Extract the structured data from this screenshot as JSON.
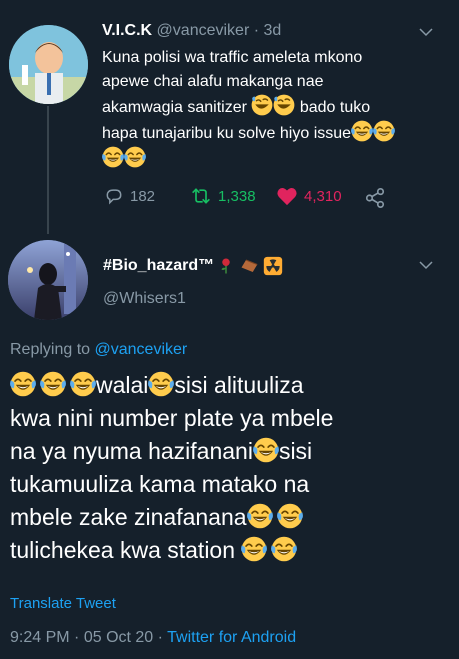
{
  "parent_tweet": {
    "display_name": "V.I.C.K",
    "handle": "@vanceviker",
    "time": "3d",
    "text_lines": [
      "Kuna polisi wa traffic ameleta mkono",
      "apewe chai alafu makanga nae",
      "akamwagia sanitizer",
      " bado tuko",
      "hapa tunajaribu ku solve hiyo issue"
    ],
    "replies": "182",
    "retweets": "1,338",
    "likes": "4,310",
    "icons": [
      "reply-icon",
      "retweet-icon",
      "heart-icon",
      "share-icon",
      "chevron-down-icon"
    ],
    "colors": {
      "retweet": "#17bf63",
      "like": "#e0245e"
    }
  },
  "main_tweet": {
    "display_name": "#Bio_hazard™",
    "handle": "@Whisers1",
    "replying_to_prefix": "Replying to",
    "replying_to_handle": "@vanceviker",
    "text_lines": [
      "walai",
      "sisi alituuliza",
      "kwa nini number plate ya mbele",
      "na ya nyuma hazifanani",
      "sisi",
      "tukamuuliza kama matako na",
      "mbele zake zinafanana",
      "tulichekea kwa station"
    ],
    "translate": "Translate Tweet",
    "time": "9:24 PM",
    "date": "05 Oct 20",
    "source": "Twitter for Android"
  },
  "colors": {
    "background": "#15202b",
    "text": "#ffffff",
    "muted": "#8899a6",
    "link": "#1da1f2",
    "divider": "#38444d"
  }
}
